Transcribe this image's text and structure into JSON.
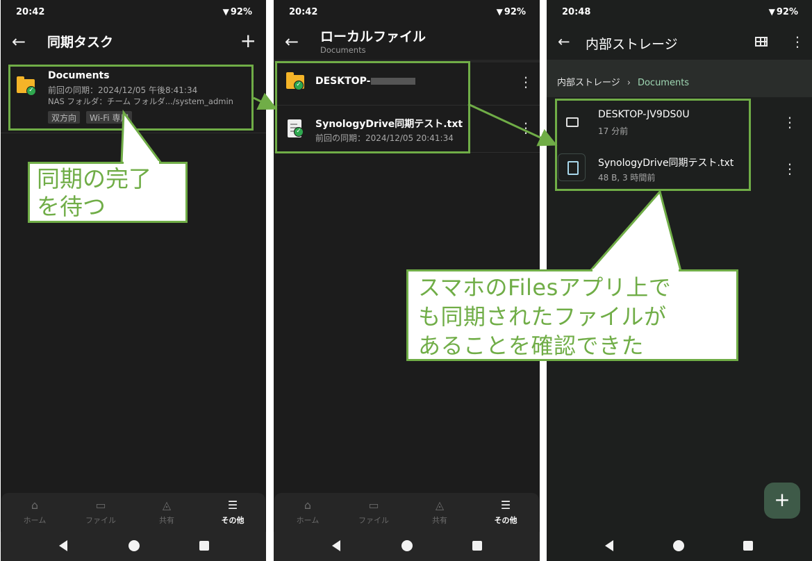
{
  "colors": {
    "accent_green": "#70ad47",
    "folder_yellow": "#f5b428",
    "check_green": "#2fa84f",
    "breadcrumb_active": "#9fd7b3"
  },
  "screen1": {
    "status": {
      "time": "20:42",
      "battery": "92%"
    },
    "title": "同期タスク",
    "task": {
      "name": "Documents",
      "last_sync": "前回の同期：2024/12/05 午後8:41:34",
      "nas_folder": "NAS フォルダ：チーム フォルダ.../system_admin",
      "tags": [
        "双方向",
        "Wi-Fi 専用"
      ]
    },
    "nav": [
      "ホーム",
      "ファイル",
      "共有",
      "その他"
    ]
  },
  "screen2": {
    "status": {
      "time": "20:42",
      "battery": "92%"
    },
    "title": "ローカルファイル",
    "subtitle": "Documents",
    "items": [
      {
        "name": "DESKTOP-",
        "detail": ""
      },
      {
        "name": "SynologyDrive同期テスト.txt",
        "detail": "前回の同期：2024/12/05 20:41:34"
      }
    ],
    "nav": [
      "ホーム",
      "ファイル",
      "共有",
      "その他"
    ]
  },
  "screen3": {
    "status": {
      "time": "20:48",
      "battery": "92%"
    },
    "title": "内部ストレージ",
    "breadcrumb": [
      "内部ストレージ",
      "Documents"
    ],
    "items": [
      {
        "name": "DESKTOP-JV9DS0U",
        "detail": "17 分前"
      },
      {
        "name": "SynologyDrive同期テスト.txt",
        "detail": "48 B, 3 時間前"
      }
    ]
  },
  "callouts": {
    "wait": [
      "同期の完了",
      "を待つ"
    ],
    "confirm": [
      "スマホのFilesアプリ上で",
      "も同期されたファイルが",
      "あることを確認できた"
    ]
  }
}
